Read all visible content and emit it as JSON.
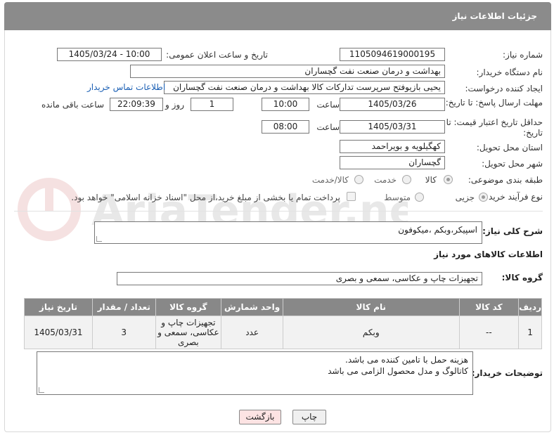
{
  "header": {
    "title": "جزئیات اطلاعات نیاز"
  },
  "form": {
    "need_number_label": "شماره نیاز:",
    "need_number": "1105094619000195",
    "announce_label": "تاریخ و ساعت اعلان عمومی:",
    "announce_value": "1405/03/24 - 10:00",
    "buyer_org_label": "نام دستگاه خریدار:",
    "buyer_org": "بهداشت و درمان صنعت نفت گچساران",
    "requester_label": "ایجاد کننده درخواست:",
    "requester": "یحیی بازیوفتح سرپرست تدارکات کالا  بهداشت و درمان صنعت نفت گچساران",
    "contact_link": "اطلاعات تماس خریدار",
    "deadline_label": "مهلت ارسال پاسخ: تا تاریخ:",
    "deadline_date": "1405/03/26",
    "time_label": "ساعت",
    "deadline_time": "10:00",
    "days_value": "1",
    "days_label": "روز و",
    "remaining_value": "22:09:39",
    "remaining_label": "ساعت باقی مانده",
    "price_validity_label": "حداقل تاریخ اعتبار قیمت: تا تاریخ:",
    "price_date": "1405/03/31",
    "price_time": "08:00",
    "province_label": "استان محل تحویل:",
    "province": "کهگیلویه و بویراحمد",
    "city_label": "شهر محل تحویل:",
    "city": "گچساران",
    "category_label": "طبقه بندی موضوعی:",
    "category_options": [
      "کالا",
      "خدمت",
      "کالا/خدمت"
    ],
    "process_label": "نوع فرآیند خرید :",
    "process_options": [
      "جزیی",
      "متوسط"
    ],
    "payment_note": "پرداخت تمام یا بخشی از مبلغ خرید،از محل \"اسناد خزانه اسلامی\" خواهد بود."
  },
  "description": {
    "label": "شرح کلی نیاز:",
    "value": "اسپیکر،وبکم ،میکوفون"
  },
  "goods_info": {
    "heading": "اطلاعات کالاهای مورد نیاز",
    "group_label": "گروه کالا:",
    "group_value": "تجهیزات چاپ و عکاسی، سمعی و بصری"
  },
  "table": {
    "headers": [
      "ردیف",
      "کد کالا",
      "نام کالا",
      "واحد شمارش",
      "گروه کالا",
      "تعداد / مقدار",
      "تاریخ نیاز"
    ],
    "rows": [
      [
        "1",
        "--",
        "وبکم",
        "عدد",
        "تجهیزات چاپ و عکاسی، سمعی و بصری",
        "3",
        "1405/03/31"
      ]
    ]
  },
  "buyer_notes": {
    "label": "توضیحات خریدار:",
    "line1": "هزینه حمل با تامین کننده می باشد.",
    "line2": "کاتالوگ و مدل محصول الزامی می باشد"
  },
  "buttons": {
    "print": "چاپ",
    "back": "بازگشت"
  },
  "watermark": {
    "text": "AriaTender.net"
  },
  "colors": {
    "header_bg": "#8b8b8b",
    "table_header_bg": "#888888",
    "link": "#1a5fb4",
    "back_button_bg": "#fde3e3"
  }
}
